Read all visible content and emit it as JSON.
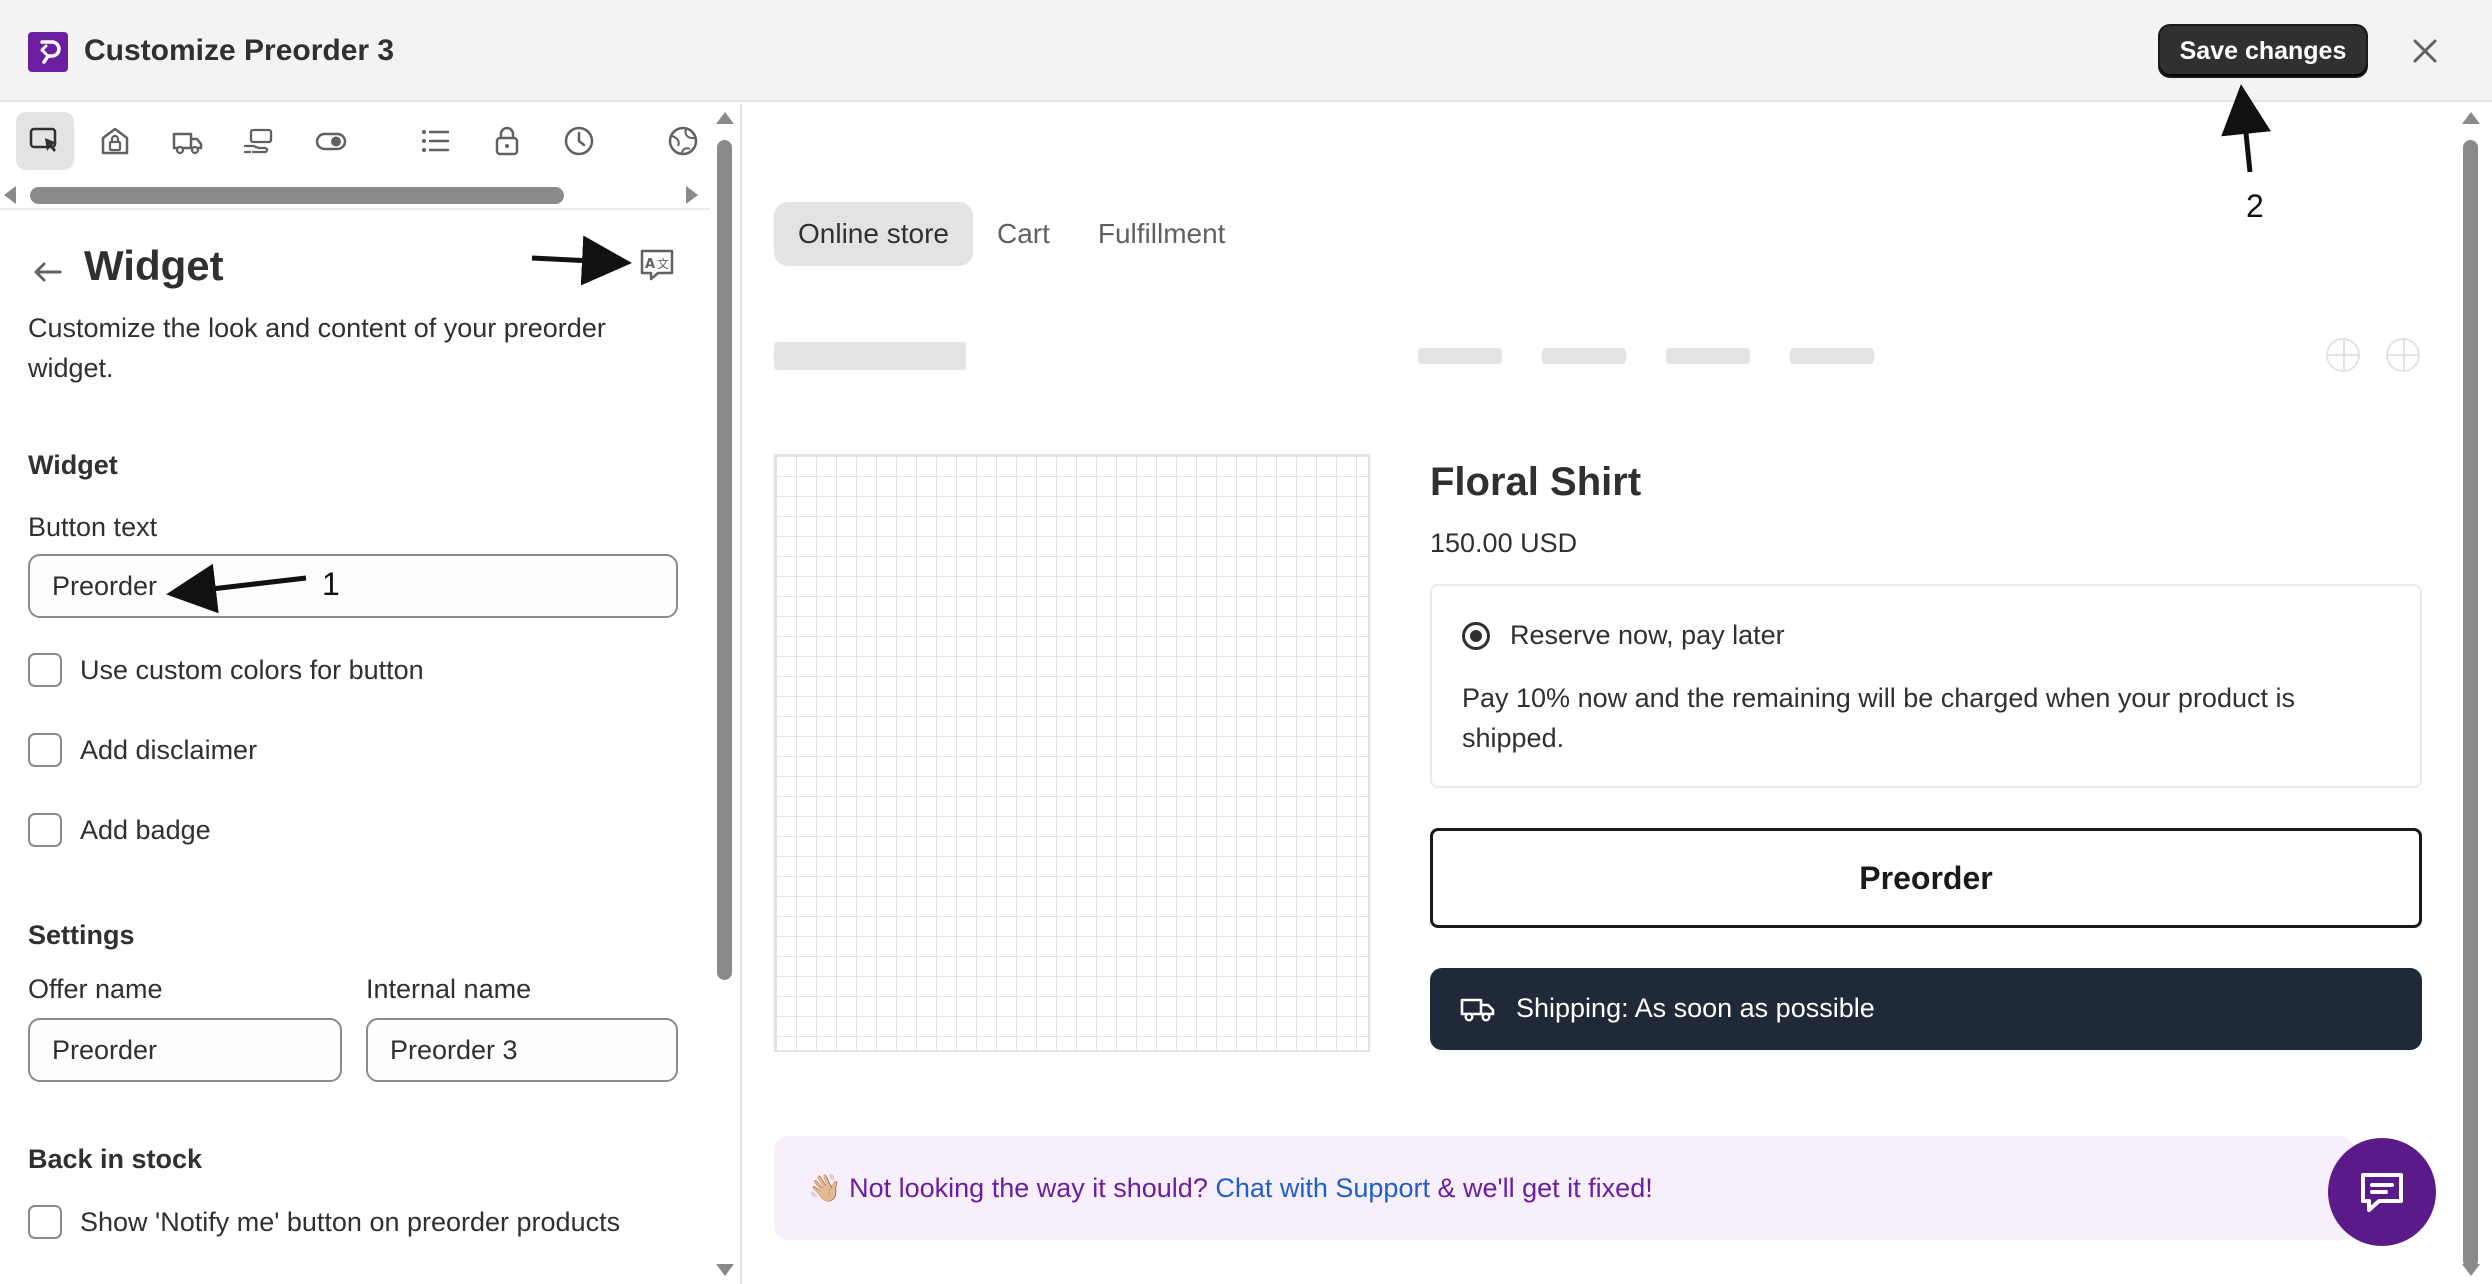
{
  "header": {
    "title": "Customize Preorder 3",
    "save_label": "Save changes",
    "logo_icon": "app-logo-icon",
    "close_icon": "close-icon"
  },
  "colors": {
    "brand": "#6b1ea0",
    "save_button": "#303030",
    "shipping_bar": "#1f2937",
    "support_bg": "#f7effc",
    "support_text": "#6b1ea0",
    "link": "#1f5fc9"
  },
  "toolbar": {
    "icons": [
      "cursor-select-icon",
      "store-lock-icon",
      "delivery-truck-icon",
      "hand-payment-icon",
      "toggle-icon",
      "list-icon",
      "lock-icon",
      "clock-icon",
      "globe-icon"
    ]
  },
  "panel": {
    "title": "Widget",
    "description": "Customize the look and content of your preorder widget.",
    "widget_section": "Widget",
    "button_text_label": "Button text",
    "button_text_value": "Preorder",
    "checkboxes": [
      {
        "label": "Use custom colors for button",
        "checked": false
      },
      {
        "label": "Add disclaimer",
        "checked": false
      },
      {
        "label": "Add badge",
        "checked": false
      }
    ],
    "settings_section": "Settings",
    "offer_name_label": "Offer name",
    "offer_name_value": "Preorder",
    "internal_name_label": "Internal name",
    "internal_name_value": "Preorder 3",
    "back_in_stock_section": "Back in stock",
    "notify_label": "Show 'Notify me' button on preorder products"
  },
  "annotations": {
    "one": "1",
    "two": "2"
  },
  "preview": {
    "tabs": [
      {
        "label": "Online store",
        "active": true
      },
      {
        "label": "Cart",
        "active": false
      },
      {
        "label": "Fulfillment",
        "active": false
      }
    ],
    "product_name": "Floral Shirt",
    "price": "150.00 USD",
    "option_label": "Reserve now, pay later",
    "option_description": "Pay 10% now and the remaining will be charged when your product is shipped.",
    "preorder_button": "Preorder",
    "shipping_text": "Shipping: As soon as possible",
    "support_prefix": "👋🏼 Not looking the way it should? ",
    "support_link": "Chat with Support",
    "support_suffix": " & we'll get it fixed!"
  }
}
